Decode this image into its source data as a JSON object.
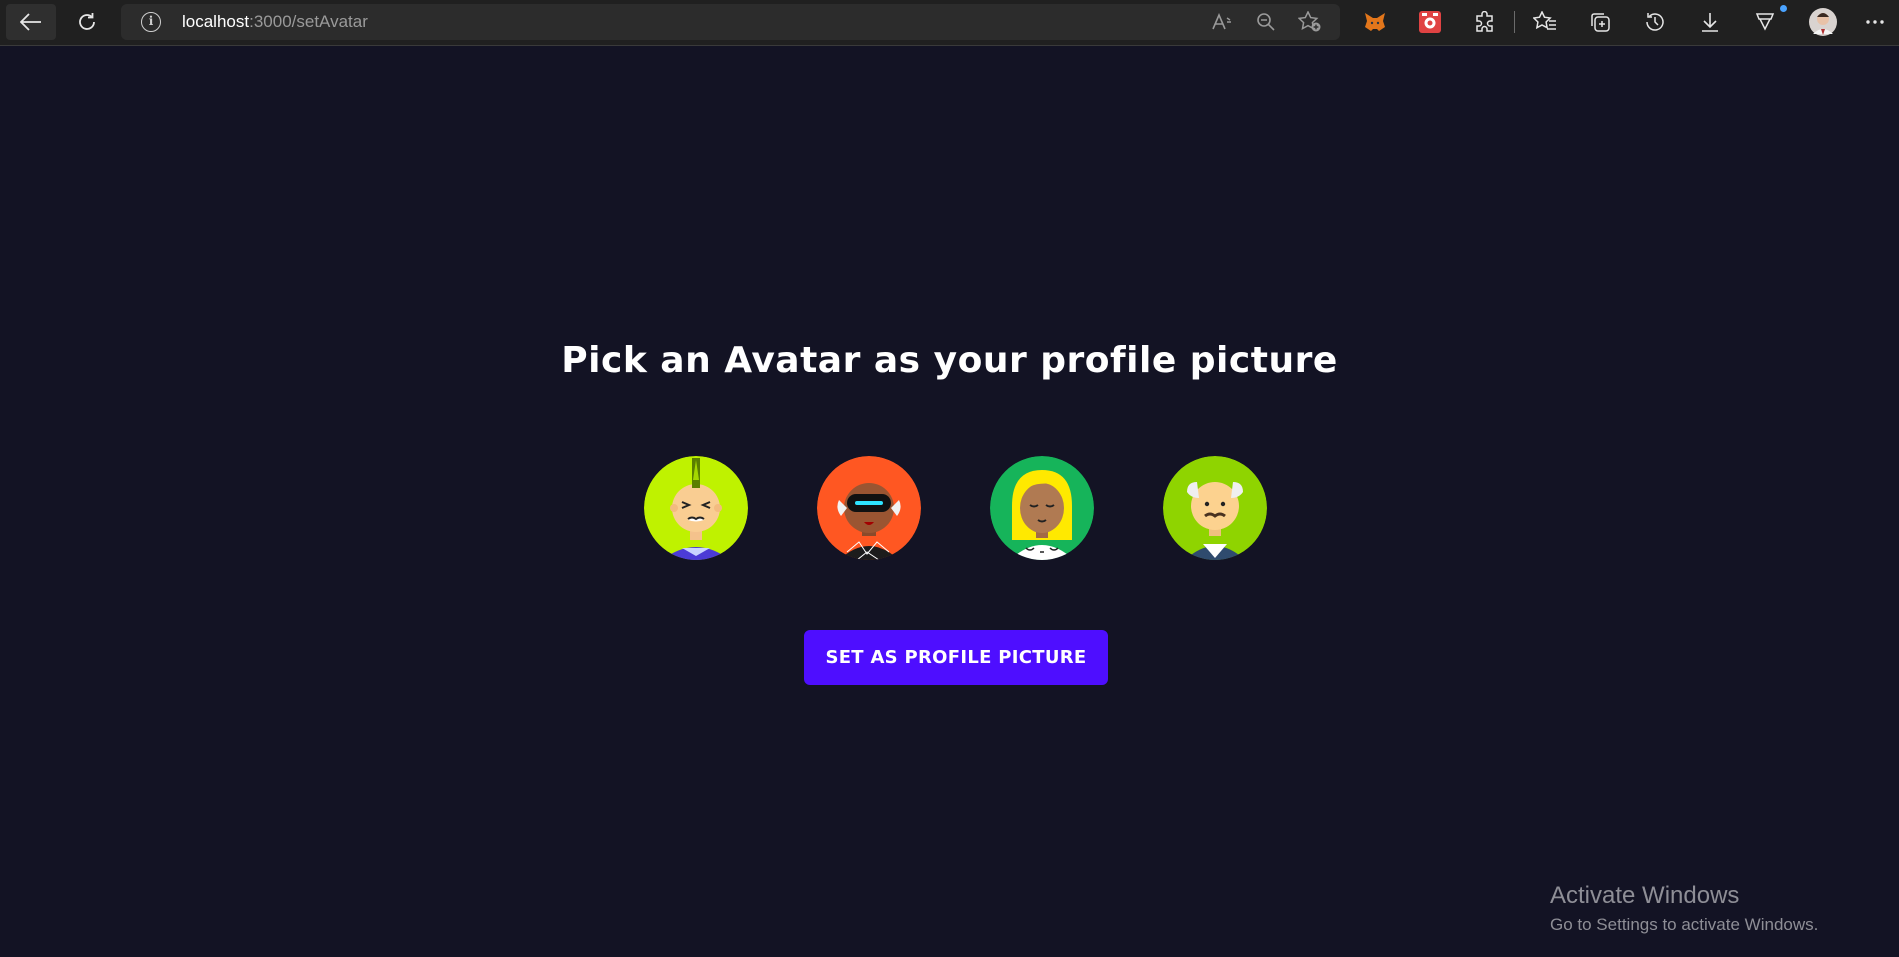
{
  "browser": {
    "url_host": "localhost",
    "url_path": ":3000/setAvatar",
    "icons": [
      "back-arrow-icon",
      "reload-icon",
      "site-info-icon",
      "read-aloud-icon",
      "zoom-out-icon",
      "add-favorite-icon",
      "metamask-extension-icon",
      "red-extension-icon",
      "extensions-icon",
      "favorites-icon",
      "collections-icon",
      "history-icon",
      "downloads-icon",
      "browser-essentials-icon",
      "profile-avatar",
      "more-menu-icon"
    ]
  },
  "page": {
    "title": "Pick an Avatar as your profile picture",
    "button_label": "SET AS PROFILE PICTURE",
    "avatars": [
      {
        "name": "avatar-1",
        "bg": "#bff200"
      },
      {
        "name": "avatar-2",
        "bg": "#ff5722"
      },
      {
        "name": "avatar-3",
        "bg": "#16b45a"
      },
      {
        "name": "avatar-4",
        "bg": "#8fd400"
      }
    ]
  },
  "colors": {
    "background": "#131324",
    "button": "#4e0eff"
  },
  "watermark": {
    "title": "Activate Windows",
    "subtitle": "Go to Settings to activate Windows."
  }
}
